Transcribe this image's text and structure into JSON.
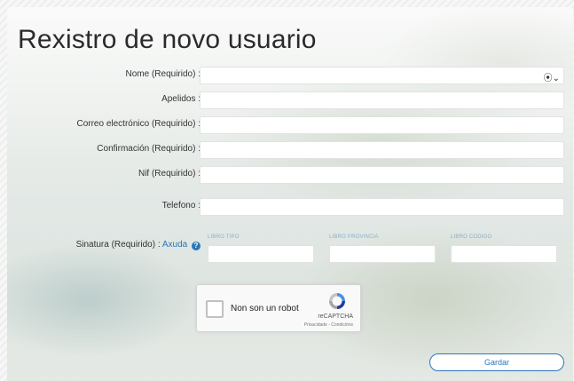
{
  "page": {
    "title": "Rexistro de novo usuario"
  },
  "form": {
    "fields": [
      {
        "label": "Nome (Requirido) :",
        "value": ""
      },
      {
        "label": "Apelidos :",
        "value": ""
      },
      {
        "label": "Correo electrónico (Requirido) :",
        "value": ""
      },
      {
        "label": "Confirmación (Requirido) :",
        "value": ""
      },
      {
        "label": "Nif (Requirido) :",
        "value": ""
      },
      {
        "label": "Telefono :",
        "value": ""
      }
    ],
    "name_field_icon": "user-circle-icon",
    "name_field_icon_glyph": "⦿⌄",
    "signature": {
      "label": "Sinatura (Requirido) :",
      "help_link": "Axuda",
      "help_icon": "?",
      "columns": [
        {
          "caption": "LIBRO TIPO",
          "value": ""
        },
        {
          "caption": "LIBRO PROVINCIA",
          "value": ""
        },
        {
          "caption": "LIBRO CODIGO",
          "value": ""
        }
      ]
    }
  },
  "captcha": {
    "label": "Non son un robot",
    "brand": "reCAPTCHA",
    "terms": "Privacidade - Condicións"
  },
  "actions": {
    "save_label": "Gardar"
  },
  "colors": {
    "accent": "#2a77b8",
    "caption": "#8ab0cc"
  }
}
